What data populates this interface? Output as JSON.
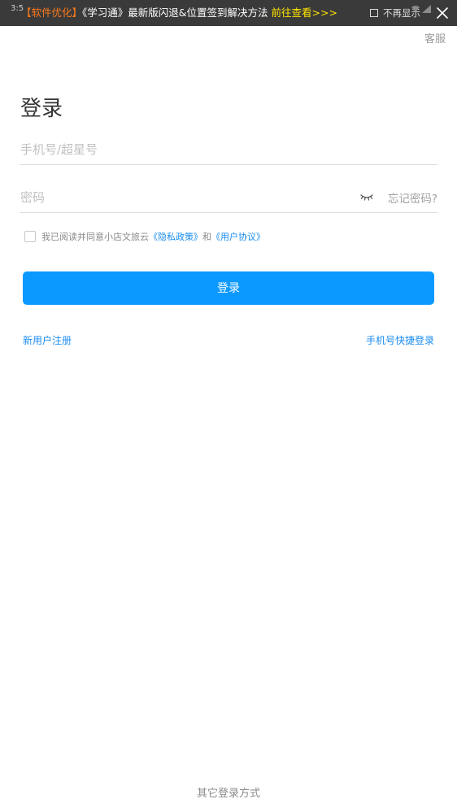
{
  "status_bar": {
    "time": "3:5"
  },
  "banner": {
    "tag": "【软件优化】",
    "title": "《学习通》最新版闪退&位置签到解决方法",
    "link": "前往查看>>>",
    "dismiss_label": "不再显示"
  },
  "header": {
    "service_link": "客服"
  },
  "login": {
    "title": "登录",
    "account_placeholder": "手机号/超星号",
    "password_placeholder": "密码",
    "forgot_password": "忘记密码?",
    "agreement": {
      "prefix": "我已阅读并同意小店文旅云",
      "privacy_link": "《隐私政策》",
      "conjunction": "和",
      "terms_link": "《用户协议》"
    },
    "submit_label": "登录",
    "register_link": "新用户注册",
    "quick_login_link": "手机号快捷登录",
    "other_methods": "其它登录方式"
  },
  "colors": {
    "primary": "#0b99ff",
    "link": "#1a8cf0",
    "banner_bg": "#3a3a3a",
    "banner_tag": "#ff7a1a",
    "banner_link": "#ffe400"
  }
}
